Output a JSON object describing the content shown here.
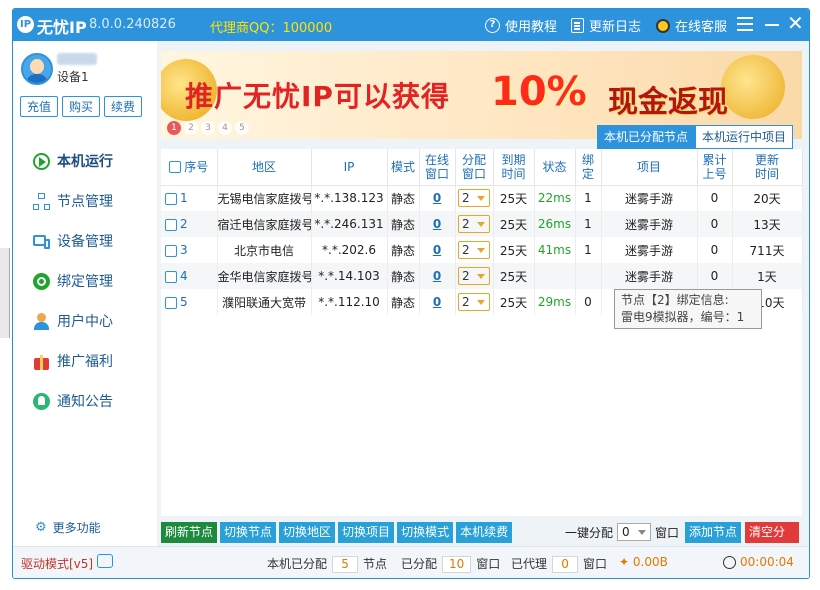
{
  "titlebar": {
    "app_name": "无忧IP",
    "version": "8.0.0.240826",
    "agent": "代理商QQ：100000",
    "tutorial": "使用教程",
    "changelog": "更新日志",
    "support": "在线客服"
  },
  "sidebar": {
    "device": "设备1",
    "recharge": "充值",
    "buy": "购买",
    "renew": "续费",
    "items": [
      {
        "label": "本机运行",
        "icon": "play-icon"
      },
      {
        "label": "节点管理",
        "icon": "node-tree-icon"
      },
      {
        "label": "设备管理",
        "icon": "device-icon"
      },
      {
        "label": "绑定管理",
        "icon": "bind-icon"
      },
      {
        "label": "用户中心",
        "icon": "user-icon"
      },
      {
        "label": "推广福利",
        "icon": "gift-icon"
      },
      {
        "label": "通知公告",
        "icon": "bell-icon"
      }
    ],
    "more": "更多功能"
  },
  "banner": {
    "headline": "推广无忧IP可以获得",
    "percent": "10%",
    "cash": "现金返现",
    "dots": [
      "1",
      "2",
      "3",
      "4",
      "5"
    ],
    "tab_assigned": "本机已分配节点",
    "tab_running": "本机运行中项目"
  },
  "table": {
    "headers": {
      "idx": "序号",
      "region": "地区",
      "ip": "IP",
      "mode": "模式",
      "online1": "在线",
      "online2": "窗口",
      "assign1": "分配",
      "assign2": "窗口",
      "expire1": "到期",
      "expire2": "时间",
      "status": "状态",
      "bind1": "绑",
      "bind2": "定",
      "project": "项目",
      "cum1": "累计",
      "cum2": "上号",
      "update1": "更新",
      "update2": "时间"
    },
    "rows": [
      {
        "idx": "1",
        "region": "无锡电信家庭拨号",
        "ip": "*.*.138.123",
        "mode": "静态",
        "online": "0",
        "assign": "2",
        "expire": "25天",
        "status": "22ms",
        "bind": "1",
        "project": "迷雾手游",
        "cum": "0",
        "update": "20天"
      },
      {
        "idx": "2",
        "region": "宿迁电信家庭拨号",
        "ip": "*.*.246.131",
        "mode": "静态",
        "online": "0",
        "assign": "2",
        "expire": "25天",
        "status": "26ms",
        "bind": "1",
        "project": "迷雾手游",
        "cum": "0",
        "update": "13天"
      },
      {
        "idx": "3",
        "region": "北京市电信",
        "ip": "*.*.202.6",
        "mode": "静态",
        "online": "0",
        "assign": "2",
        "expire": "25天",
        "status": "41ms",
        "bind": "1",
        "project": "迷雾手游",
        "cum": "0",
        "update": "711天"
      },
      {
        "idx": "4",
        "region": "金华电信家庭拨号",
        "ip": "*.*.14.103",
        "mode": "静态",
        "online": "0",
        "assign": "2",
        "expire": "25天",
        "status": "",
        "bind": "",
        "project": "迷雾手游",
        "cum": "0",
        "update": "1天"
      },
      {
        "idx": "5",
        "region": "濮阳联通大宽带",
        "ip": "*.*.112.10",
        "mode": "静态",
        "online": "0",
        "assign": "2",
        "expire": "25天",
        "status": "29ms",
        "bind": "0",
        "project": "迷雾手游",
        "cum": "0",
        "update": "510天"
      }
    ],
    "tooltip_line1": "节点【2】绑定信息:",
    "tooltip_line2": "雷电9模拟器，编号：1"
  },
  "toolbar": {
    "refresh": "刷新节点",
    "switch_node": "切换节点",
    "switch_region": "切换地区",
    "switch_project": "切换项目",
    "switch_mode": "切换模式",
    "renew": "本机续费",
    "one_key": "一键分配",
    "one_key_value": "0",
    "window": "窗口",
    "add_node": "添加节点",
    "clear": "清空分配"
  },
  "status": {
    "driver": "驱动模式[v5]",
    "assigned_label": "本机已分配",
    "assigned_count": "5",
    "node_unit": "节点",
    "allocated_label": "已分配",
    "allocated_count": "10",
    "window_unit": "窗口",
    "proxied_label": "已代理",
    "proxied_count": "0",
    "window_unit2": "窗口",
    "traffic": "0.00B",
    "timer": "00:00:04"
  }
}
